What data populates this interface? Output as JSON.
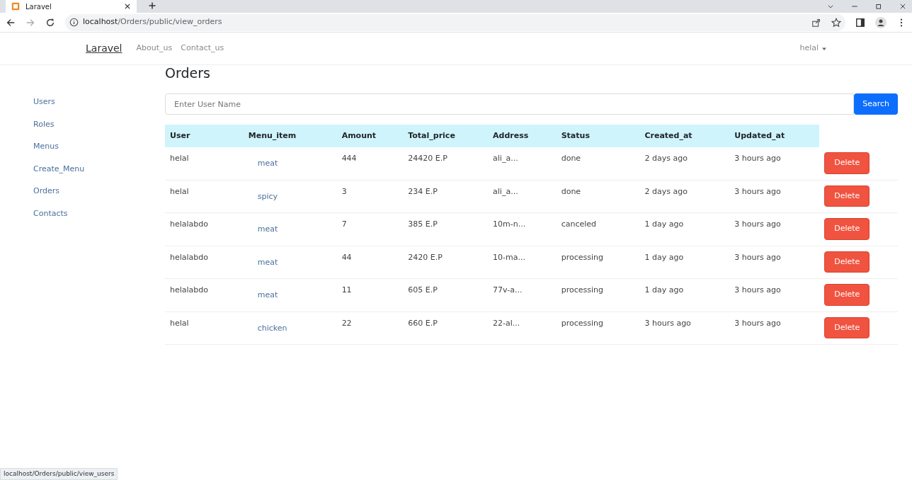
{
  "browser": {
    "tab_title": "Laravel",
    "address": {
      "host": "localhost",
      "path": "/Orders/public/view_orders"
    },
    "status_url": "localhost/Orders/public/view_users"
  },
  "navbar": {
    "brand": "Laravel",
    "links": [
      "About_us",
      "Contact_us"
    ],
    "user_menu": "helal"
  },
  "sidebar": {
    "items": [
      {
        "label": "Users"
      },
      {
        "label": "Roles"
      },
      {
        "label": "Menus"
      },
      {
        "label": "Create_Menu"
      },
      {
        "label": "Orders"
      },
      {
        "label": "Contacts"
      }
    ]
  },
  "page_title": "Orders",
  "search": {
    "placeholder": "Enter User Name",
    "button": "Search"
  },
  "table": {
    "columns": [
      "User",
      "Menu_item",
      "Amount",
      "Total_price",
      "Address",
      "Status",
      "Created_at",
      "Updated_at"
    ],
    "rows": [
      {
        "user": "helal",
        "menu_item": "meat",
        "amount": "444",
        "total_price": "24420 E.P",
        "address": "ali_a...",
        "status": "done",
        "created_at": "2 days ago",
        "updated_at": "3 hours ago",
        "action": "Delete"
      },
      {
        "user": "helal",
        "menu_item": "spicy",
        "amount": "3",
        "total_price": "234 E.P",
        "address": "ali_a...",
        "status": "done",
        "created_at": "2 days ago",
        "updated_at": "3 hours ago",
        "action": "Delete"
      },
      {
        "user": "helalabdo",
        "menu_item": "meat",
        "amount": "7",
        "total_price": "385 E.P",
        "address": "10m-n...",
        "status": "canceled",
        "created_at": "1 day ago",
        "updated_at": "3 hours ago",
        "action": "Delete"
      },
      {
        "user": "helalabdo",
        "menu_item": "meat",
        "amount": "44",
        "total_price": "2420 E.P",
        "address": "10-ma...",
        "status": "processing",
        "created_at": "1 day ago",
        "updated_at": "3 hours ago",
        "action": "Delete"
      },
      {
        "user": "helalabdo",
        "menu_item": "meat",
        "amount": "11",
        "total_price": "605 E.P",
        "address": "77v-a...",
        "status": "processing",
        "created_at": "1 day ago",
        "updated_at": "3 hours ago",
        "action": "Delete"
      },
      {
        "user": "helal",
        "menu_item": "chicken",
        "amount": "22",
        "total_price": "660 E.P",
        "address": "22-al...",
        "status": "processing",
        "created_at": "3 hours ago",
        "updated_at": "3 hours ago",
        "action": "Delete"
      }
    ]
  }
}
